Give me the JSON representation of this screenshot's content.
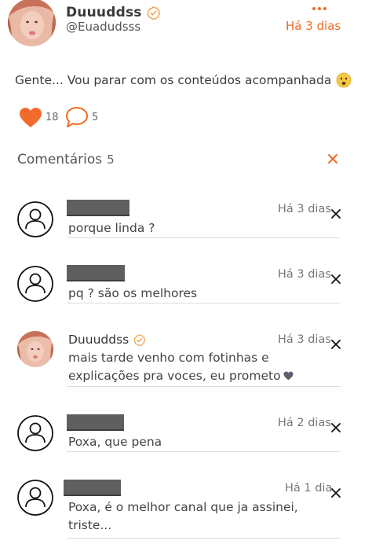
{
  "post": {
    "username": "Duuuddss",
    "handle": "@Euadudsss",
    "time": "Há 3 dias",
    "text": "Gente... Vou parar com os conteúdos acompanhada",
    "emoji": "frowning-face-icon",
    "likes": "18",
    "comments": "5"
  },
  "comments_section": {
    "heading": "Comentários",
    "count": "5"
  },
  "comments": [
    {
      "name": "",
      "name_redacted": true,
      "time": "Há 3 dias",
      "text": "porque linda ?"
    },
    {
      "name": "",
      "name_redacted": true,
      "time": "Há 3 dias",
      "text": "pq ? são os melhores"
    },
    {
      "name": "Duuuddss",
      "name_redacted": false,
      "verified": true,
      "time": "Há 3 dias",
      "text_line1": "mais tarde venho com fotinhas e",
      "text_line2": "explicações pra voces, eu prometo"
    },
    {
      "name": "",
      "name_redacted": true,
      "time": "Há 2 dias",
      "text": "Poxa, que pena"
    },
    {
      "name": "",
      "name_redacted": true,
      "time": "Há 1 dia",
      "text_line1": "Poxa, é o melhor canal que ja assinei,",
      "text_line2": "triste..."
    }
  ],
  "colors": {
    "accent": "#ee6a24",
    "heart": "#f26b2c",
    "verified": "#f0a050"
  }
}
